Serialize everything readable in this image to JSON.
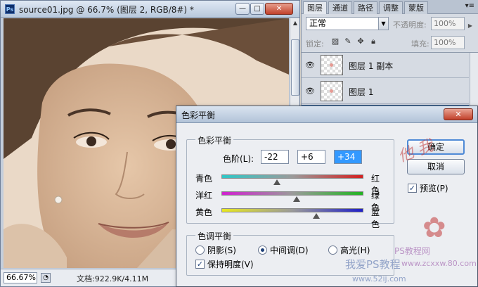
{
  "document": {
    "title": "source01.jpg @ 66.7% (图层 2, RGB/8#) *",
    "zoom": "66.67%",
    "info": "文档:922.9K/4.11M"
  },
  "panel": {
    "tabs": [
      "图层",
      "通道",
      "路径",
      "调整",
      "蒙版"
    ],
    "blend_mode": "正常",
    "opacity_label": "不透明度:",
    "opacity_value": "100%",
    "lock_label": "锁定:",
    "fill_label": "填充:",
    "fill_value": "100%",
    "layers": [
      {
        "name": "图层 1 副本"
      },
      {
        "name": "图层 1"
      },
      {
        "name": ""
      }
    ]
  },
  "dialog": {
    "title": "色彩平衡",
    "group_title": "色彩平衡",
    "levels_label": "色阶(L):",
    "levels": [
      "-22",
      "+6",
      "+34"
    ],
    "sliders": [
      {
        "left": "青色",
        "right": "红色",
        "value": -22,
        "color_start": "#2ec7c7",
        "color_end": "#d42020"
      },
      {
        "left": "洋红",
        "right": "绿色",
        "value": 6,
        "color_start": "#d020d0",
        "color_end": "#22b422"
      },
      {
        "left": "黄色",
        "right": "蓝色",
        "value": 34,
        "color_start": "#e8e820",
        "color_end": "#2020c8"
      }
    ],
    "tone_group_title": "色调平衡",
    "tones": [
      {
        "label": "阴影(S)",
        "checked": false
      },
      {
        "label": "中间调(D)",
        "checked": true
      },
      {
        "label": "高光(H)",
        "checked": false
      }
    ],
    "preserve_label": "保持明度(V)",
    "ok": "确定",
    "cancel": "取消",
    "preview_label": "预览(P)"
  },
  "watermarks": {
    "site_cn": "PS教程网",
    "site_big": "我爱PS教程",
    "url": "www.52ij.com",
    "url2": "www.zcxxw.80.com"
  }
}
